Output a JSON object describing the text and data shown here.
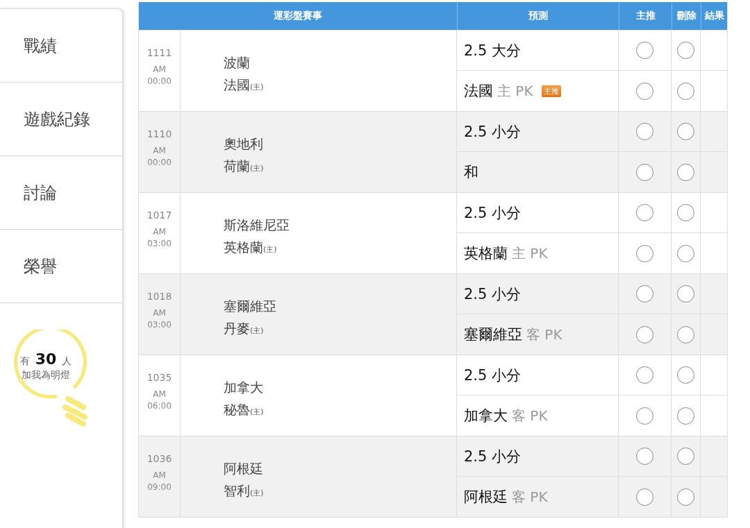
{
  "sidebar": {
    "items": [
      {
        "label": "戰績",
        "selected": false
      },
      {
        "label": "遊戲紀錄",
        "selected": false
      },
      {
        "label": "討論",
        "selected": false
      },
      {
        "label": "榮譽",
        "selected": false
      }
    ],
    "fans": {
      "prefix": "有",
      "count": "30",
      "suffix": "人",
      "caption": "加我為明燈"
    }
  },
  "table": {
    "columns": [
      "運彩盤賽事",
      "預測",
      "主推",
      "刪除",
      "結果"
    ],
    "matches": [
      {
        "no": "1111",
        "ampm": "AM",
        "time": "00:00",
        "away": "波蘭",
        "home": "法國",
        "home_mark": "(主)",
        "predictions": [
          {
            "text": "2.5 大分",
            "featured": false,
            "delete": false
          },
          {
            "text": "法國",
            "note": "主 PK",
            "badge": "主推",
            "featured": false,
            "delete": false
          }
        ]
      },
      {
        "no": "1110",
        "ampm": "AM",
        "time": "00:00",
        "away": "奧地利",
        "home": "荷蘭",
        "home_mark": "(主)",
        "predictions": [
          {
            "text": "2.5 小分",
            "featured": false,
            "delete": false
          },
          {
            "text": "和",
            "featured": false,
            "delete": false
          }
        ]
      },
      {
        "no": "1017",
        "ampm": "AM",
        "time": "03:00",
        "away": "斯洛維尼亞",
        "home": "英格蘭",
        "home_mark": "(主)",
        "predictions": [
          {
            "text": "2.5 小分",
            "featured": false,
            "delete": false
          },
          {
            "text": "英格蘭",
            "note": "主 PK",
            "featured": false,
            "delete": false
          }
        ]
      },
      {
        "no": "1018",
        "ampm": "AM",
        "time": "03:00",
        "away": "塞爾維亞",
        "home": "丹麥",
        "home_mark": "(主)",
        "predictions": [
          {
            "text": "2.5 小分",
            "featured": false,
            "delete": false
          },
          {
            "text": "塞爾維亞",
            "note": "客 PK",
            "featured": false,
            "delete": false
          }
        ]
      },
      {
        "no": "1035",
        "ampm": "AM",
        "time": "06:00",
        "away": "加拿大",
        "home": "秘魯",
        "home_mark": "(主)",
        "predictions": [
          {
            "text": "2.5 小分",
            "featured": false,
            "delete": false
          },
          {
            "text": "加拿大",
            "note": "客 PK",
            "featured": false,
            "delete": false
          }
        ]
      },
      {
        "no": "1036",
        "ampm": "AM",
        "time": "09:00",
        "away": "阿根廷",
        "home": "智利",
        "home_mark": "(主)",
        "predictions": [
          {
            "text": "2.5 小分",
            "featured": false,
            "delete": false
          },
          {
            "text": "阿根廷",
            "note": "客 PK",
            "featured": false,
            "delete": false
          }
        ]
      }
    ]
  }
}
